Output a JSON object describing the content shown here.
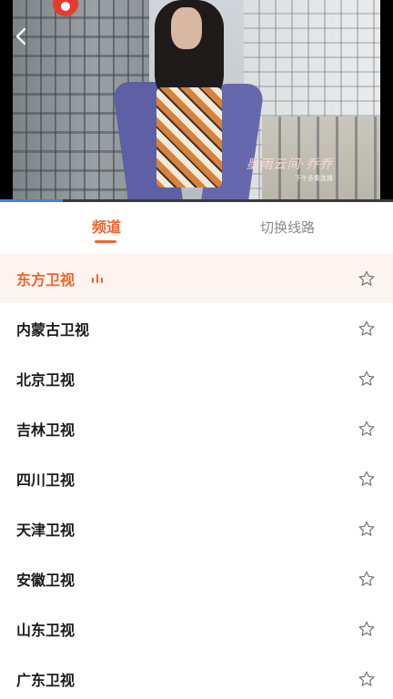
{
  "player": {
    "watermark_title": "墨雨云间·乔乔",
    "watermark_sub": "下午多集连播",
    "progress": 0.16
  },
  "tabs": [
    {
      "label": "频道",
      "active": true
    },
    {
      "label": "切换线路",
      "active": false
    }
  ],
  "channels": [
    {
      "name": "东方卫视",
      "selected": true,
      "playing": true
    },
    {
      "name": "内蒙古卫视",
      "selected": false
    },
    {
      "name": "北京卫视",
      "selected": false
    },
    {
      "name": "吉林卫视",
      "selected": false
    },
    {
      "name": "四川卫视",
      "selected": false
    },
    {
      "name": "天津卫视",
      "selected": false
    },
    {
      "name": "安徽卫视",
      "selected": false
    },
    {
      "name": "山东卫视",
      "selected": false
    },
    {
      "name": "广东卫视",
      "selected": false
    }
  ],
  "icons": {
    "back": "chevron-left-icon",
    "favorite": "star-outline-icon",
    "playing": "equalizer-bars-icon",
    "logo": "channel-logo-icon"
  },
  "colors": {
    "accent": "#f0652d",
    "selected_row_bg": "#fdf4ef",
    "progress": "#3d7ff5",
    "text": "#1b1b1b",
    "muted": "#8a8a8a"
  }
}
